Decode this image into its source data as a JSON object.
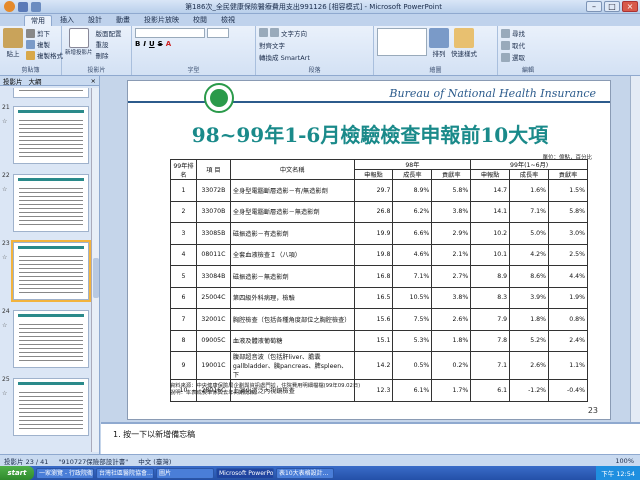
{
  "window": {
    "title": "第186次_全民健康保險醫療費用支出991126 [相容模式] - Microsoft PowerPoint"
  },
  "ribbon": {
    "tabs": [
      "常用",
      "插入",
      "設計",
      "動畫",
      "投影片放映",
      "校閱",
      "檢視"
    ],
    "clipboard": {
      "paste": "貼上",
      "cut": "剪下",
      "copy": "複製",
      "format": "複製格式",
      "label": "剪貼簿"
    },
    "slides": {
      "new": "新增投影片",
      "layout": "版面配置",
      "reset": "重設",
      "delete": "刪除",
      "label": "投影片"
    },
    "font": {
      "label": "字型"
    },
    "paragraph": {
      "label": "段落",
      "text_dir": "文字方向",
      "align": "對齊文字",
      "smartart": "轉換成 SmartArt"
    },
    "drawing": {
      "label": "繪圖",
      "arrange": "排列",
      "quick": "快速樣式"
    },
    "editing": {
      "label": "編輯",
      "find": "尋找",
      "replace": "取代",
      "select": "選取"
    }
  },
  "leftpane": {
    "tab_slides": "投影片",
    "tab_outline": "大綱",
    "close": "×",
    "thumb_numbers": [
      "20",
      "21",
      "22",
      "23",
      "24",
      "25"
    ]
  },
  "slide": {
    "bureau": "Bureau of National Health Insurance",
    "title": "98~99年1-6月檢驗檢查申報前10大項",
    "unit": "單位：億點，百分比",
    "headers": {
      "rank": "99年排名",
      "code": "項 目",
      "name": "中文名稱",
      "y98": "98年",
      "y99": "99年(1~6月)",
      "amount": "申報點",
      "growth": "成長率",
      "share": "貢獻率"
    },
    "rows": [
      {
        "rank": "1",
        "code": "33072B",
        "name": "全身型電腦斷層造影－有/無造影劑",
        "a98": "29.7",
        "g98": "8.9%",
        "s98": "5.8%",
        "a99": "14.7",
        "g99": "1.6%",
        "s99": "1.5%"
      },
      {
        "rank": "2",
        "code": "33070B",
        "name": "全身型電腦斷層造影－無造影劑",
        "a98": "26.8",
        "g98": "6.2%",
        "s98": "3.8%",
        "a99": "14.1",
        "g99": "7.1%",
        "s99": "5.8%"
      },
      {
        "rank": "3",
        "code": "33085B",
        "name": "磁振造影－有造影劑",
        "a98": "19.9",
        "g98": "6.6%",
        "s98": "2.9%",
        "a99": "10.2",
        "g99": "5.0%",
        "s99": "3.0%"
      },
      {
        "rank": "4",
        "code": "08011C",
        "name": "全套血液檢查Ｉ（八項）",
        "a98": "19.8",
        "g98": "4.6%",
        "s98": "2.1%",
        "a99": "10.1",
        "g99": "4.2%",
        "s99": "2.5%"
      },
      {
        "rank": "5",
        "code": "33084B",
        "name": "磁振造影－無造影劑",
        "a98": "16.8",
        "g98": "7.1%",
        "s98": "2.7%",
        "a99": "8.9",
        "g99": "8.6%",
        "s99": "4.4%"
      },
      {
        "rank": "6",
        "code": "25004C",
        "name": "第四級外科病理，檢驗",
        "a98": "16.5",
        "g98": "10.5%",
        "s98": "3.8%",
        "a99": "8.3",
        "g99": "3.9%",
        "s99": "1.9%"
      },
      {
        "rank": "7",
        "code": "32001C",
        "name": "胸腔檢查（包括各種角度部位之胸腔檢查）",
        "a98": "15.6",
        "g98": "7.5%",
        "s98": "2.6%",
        "a99": "7.9",
        "g99": "1.8%",
        "s99": "0.8%"
      },
      {
        "rank": "8",
        "code": "09005C",
        "name": "血液及體液葡萄糖",
        "a98": "15.1",
        "g98": "5.3%",
        "s98": "1.8%",
        "a99": "7.8",
        "g99": "5.2%",
        "s99": "2.4%"
      },
      {
        "rank": "9",
        "code": "19001C",
        "name": "腹部超音波（包括肝liver、膽囊gallbladder、胰pancreas、脾spleen、下",
        "a98": "14.2",
        "g98": "0.5%",
        "s98": "0.2%",
        "a99": "7.1",
        "g99": "2.6%",
        "s99": "1.1%"
      },
      {
        "rank": "10",
        "code": "28016C",
        "name": "上消化道泛內視鏡檢查",
        "a98": "12.3",
        "g98": "6.1%",
        "s98": "1.7%",
        "a99": "6.1",
        "g99": "-1.2%",
        "s99": "-0.4%"
      }
    ],
    "source": "資料來源：中央健康保險局企劃與資訊處門診，住院費用明細檔檔(99年09.02日)",
    "note": "說明：本表成長率係與去年同期比較。",
    "page": "23"
  },
  "notes": {
    "text": "1.  按一下以新增備忘稿"
  },
  "status": {
    "slide": "投影片 23 / 41",
    "theme": "\"910727保險部設計書\"",
    "lang": "中文 (臺灣)",
    "zoom": "100%"
  },
  "taskbar": {
    "start": "start",
    "items": [
      "一家瀏覽 - 行政院衛...",
      "台灣社區醫院協會...",
      "圖片",
      "Microsoft PowerPoi...",
      "表10大表格設計..."
    ],
    "clock": "下午 12:54"
  }
}
